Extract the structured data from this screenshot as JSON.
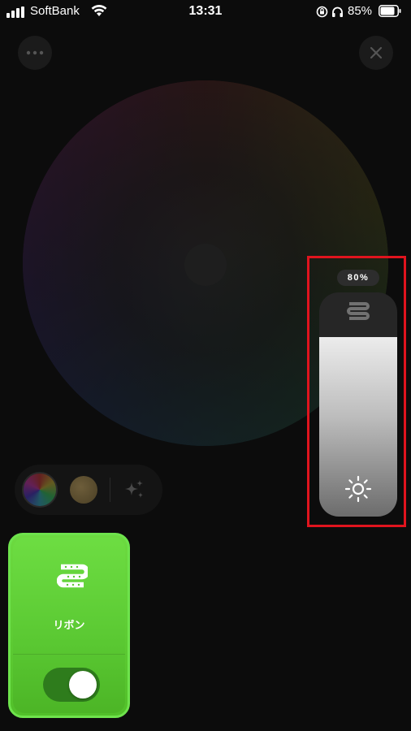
{
  "status_bar": {
    "carrier": "SoftBank",
    "time": "13:31",
    "battery_percent": "85%",
    "battery_level": 0.85
  },
  "icons": {
    "more": "more-horizontal-icon",
    "close": "close-icon",
    "effects": "sparkles-icon",
    "sun": "sun-icon",
    "device": "light-strip-icon"
  },
  "color_wheel": {
    "selected": "center"
  },
  "modes": [
    "color",
    "white",
    "effects"
  ],
  "brightness": {
    "label": "80%",
    "level": 0.8
  },
  "device": {
    "name": "リボン",
    "power_on": true,
    "accent": "#5ac832"
  },
  "highlight_color": "#e0141e"
}
